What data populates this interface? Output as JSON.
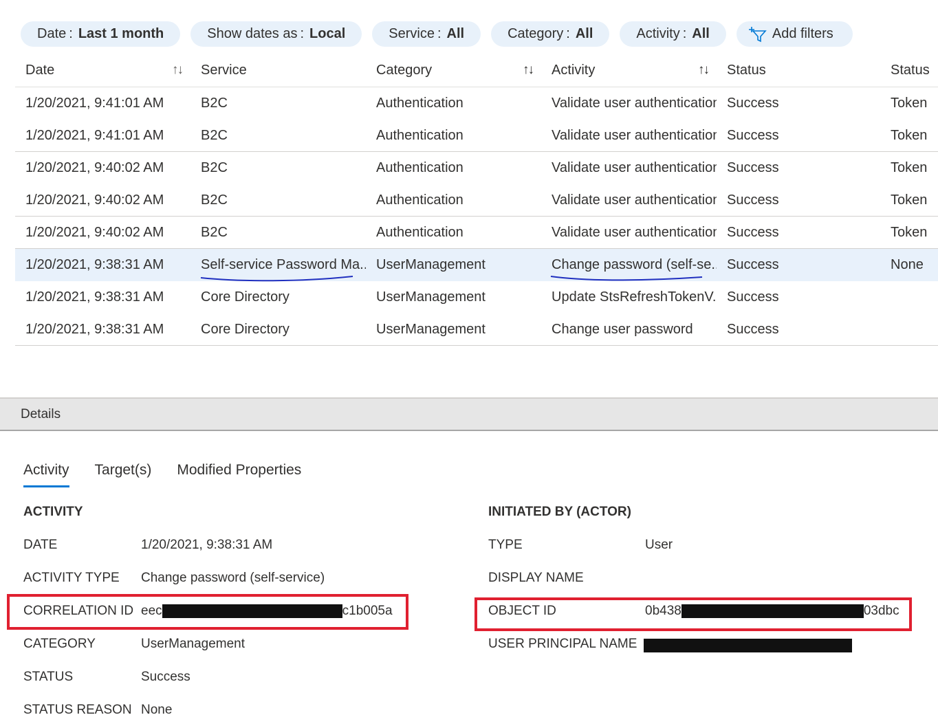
{
  "filters": [
    {
      "label": "Date",
      "value": "Last 1 month"
    },
    {
      "label": "Show dates as",
      "value": "Local"
    },
    {
      "label": "Service",
      "value": "All"
    },
    {
      "label": "Category",
      "value": "All"
    },
    {
      "label": "Activity",
      "value": "All"
    }
  ],
  "add_filters_label": "Add filters",
  "table": {
    "headers": {
      "date": "Date",
      "service": "Service",
      "category": "Category",
      "activity": "Activity",
      "status": "Status",
      "status_reason": "Status"
    },
    "rows": [
      {
        "date": "1/20/2021, 9:41:01 AM",
        "service": "B2C",
        "category": "Authentication",
        "activity": "Validate user authentication",
        "status": "Success",
        "reason": "Token"
      },
      {
        "date": "1/20/2021, 9:41:01 AM",
        "service": "B2C",
        "category": "Authentication",
        "activity": "Validate user authentication",
        "status": "Success",
        "reason": "Token"
      },
      {
        "date": "1/20/2021, 9:40:02 AM",
        "service": "B2C",
        "category": "Authentication",
        "activity": "Validate user authentication",
        "status": "Success",
        "reason": "Token"
      },
      {
        "date": "1/20/2021, 9:40:02 AM",
        "service": "B2C",
        "category": "Authentication",
        "activity": "Validate user authentication",
        "status": "Success",
        "reason": "Token"
      },
      {
        "date": "1/20/2021, 9:40:02 AM",
        "service": "B2C",
        "category": "Authentication",
        "activity": "Validate user authentication",
        "status": "Success",
        "reason": "Token"
      },
      {
        "date": "1/20/2021, 9:38:31 AM",
        "service": "Self-service Password Ma...",
        "category": "UserManagement",
        "activity": "Change password (self-se...",
        "status": "Success",
        "reason": "None"
      },
      {
        "date": "1/20/2021, 9:38:31 AM",
        "service": "Core Directory",
        "category": "UserManagement",
        "activity": "Update StsRefreshTokenV...",
        "status": "Success",
        "reason": ""
      },
      {
        "date": "1/20/2021, 9:38:31 AM",
        "service": "Core Directory",
        "category": "UserManagement",
        "activity": "Change user password",
        "status": "Success",
        "reason": ""
      }
    ]
  },
  "details": {
    "bar_title": "Details",
    "tabs": [
      "Activity",
      "Target(s)",
      "Modified Properties"
    ],
    "activity_title": "ACTIVITY",
    "activity": {
      "date_label": "DATE",
      "date": "1/20/2021, 9:38:31 AM",
      "type_label": "ACTIVITY TYPE",
      "type": "Change password (self-service)",
      "correlation_label": "CORRELATION ID",
      "correlation_prefix": "eec",
      "correlation_suffix": "c1b005a",
      "category_label": "CATEGORY",
      "category": "UserManagement",
      "status_label": "STATUS",
      "status": "Success",
      "reason_label": "STATUS REASON",
      "reason": "None"
    },
    "actor_title": "INITIATED BY (ACTOR)",
    "actor": {
      "type_label": "TYPE",
      "type": "User",
      "display_label": "DISPLAY NAME",
      "display": "",
      "object_label": "OBJECT ID",
      "object_prefix": "0b438",
      "object_suffix": "03dbc",
      "upn_label": "USER PRINCIPAL NAME"
    }
  },
  "colors": {
    "accent": "#0078d4",
    "pill_bg": "#e8f1fa",
    "selected_row": "#e8f1fb",
    "highlight_box": "#e02030",
    "annotation": "#1f2fbf"
  }
}
